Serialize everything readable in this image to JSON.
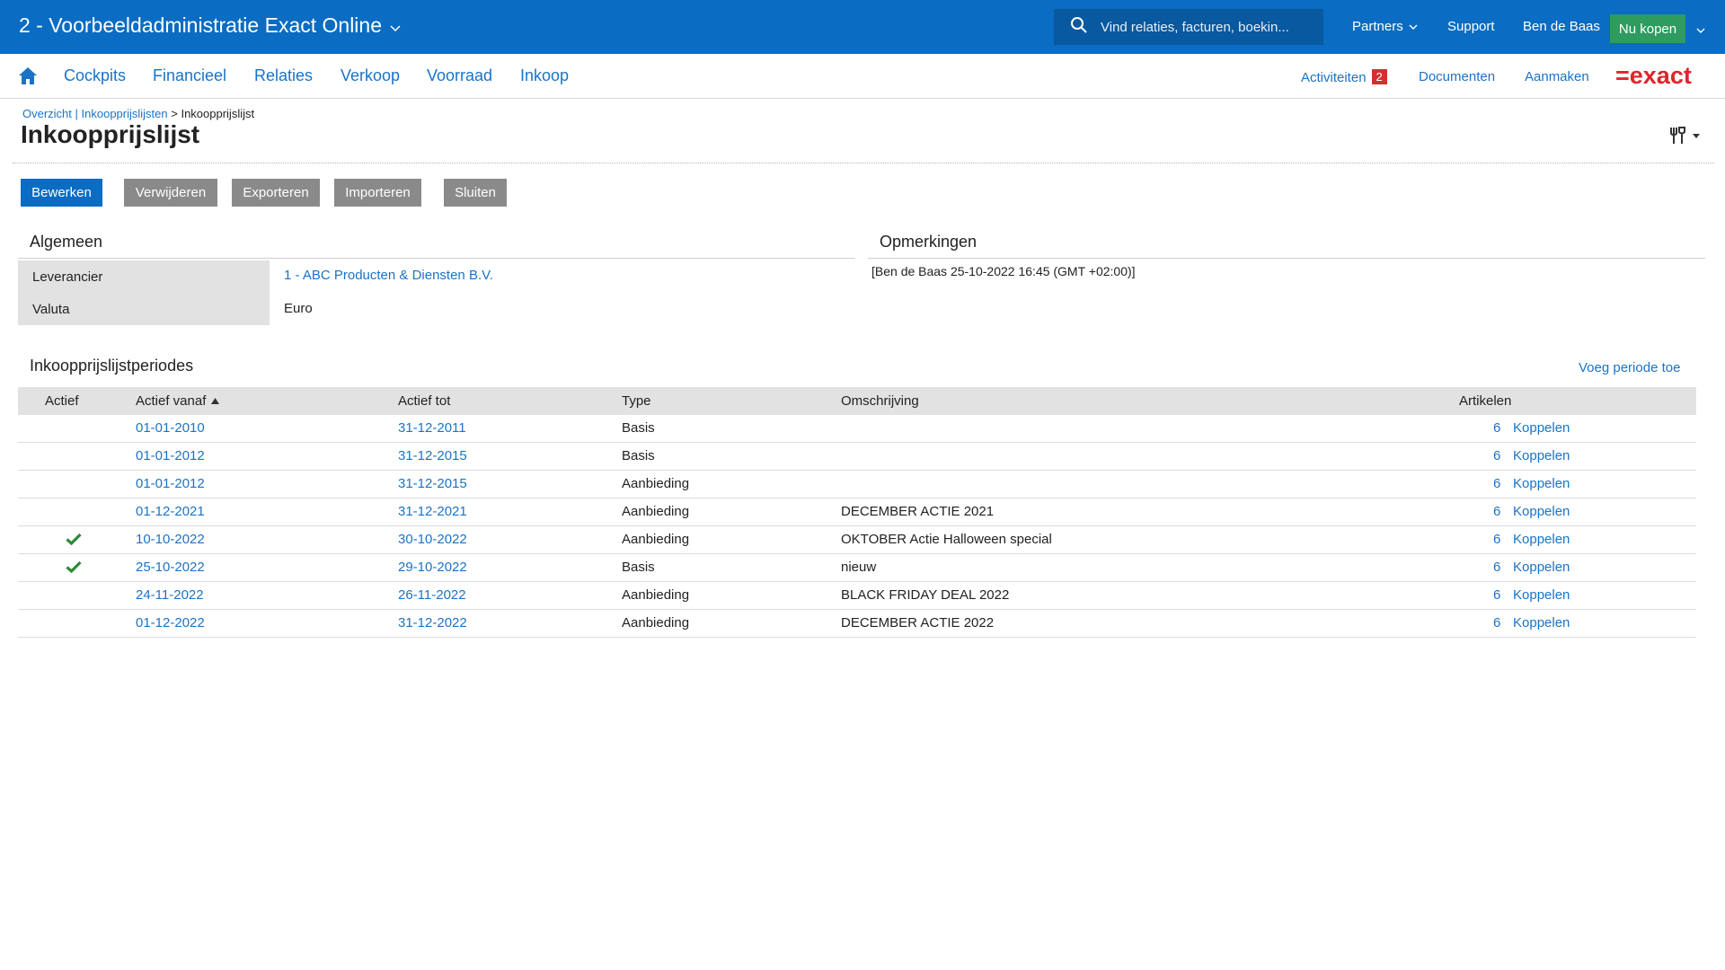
{
  "topbar": {
    "admin_title": "2 - Voorbeeldadministratie Exact Online",
    "search_placeholder": "Vind relaties, facturen, boekin...",
    "partners": "Partners",
    "support": "Support",
    "user": "Ben de Baas",
    "buy": "Nu kopen"
  },
  "nav": {
    "items": [
      "Cockpits",
      "Financieel",
      "Relaties",
      "Verkoop",
      "Voorraad",
      "Inkoop"
    ],
    "activities": "Activiteiten",
    "activities_count": "2",
    "documents": "Documenten",
    "create": "Aanmaken",
    "logo": "=exact"
  },
  "breadcrumb": {
    "overview": "Overzicht",
    "sep1": " | ",
    "lists": "Inkoopprijslijsten",
    "sep2": " > ",
    "current": "Inkoopprijslijst"
  },
  "page_title": "Inkoopprijslijst",
  "buttons": {
    "edit": "Bewerken",
    "delete": "Verwijderen",
    "export": "Exporteren",
    "import": "Importeren",
    "close": "Sluiten"
  },
  "general": {
    "heading": "Algemeen",
    "supplier_label": "Leverancier",
    "supplier_value": "1 - ABC Producten & Diensten B.V.",
    "currency_label": "Valuta",
    "currency_value": "Euro"
  },
  "remarks": {
    "heading": "Opmerkingen",
    "text": "[Ben de Baas 25-10-2022 16:45 (GMT +02:00)]"
  },
  "periods": {
    "heading": "Inkoopprijslijstperiodes",
    "add_link": "Voeg periode toe",
    "columns": {
      "active": "Actief",
      "from": "Actief vanaf",
      "to": "Actief tot",
      "type": "Type",
      "description": "Omschrijving",
      "articles": "Artikelen"
    },
    "link_label": "Koppelen",
    "rows": [
      {
        "active": false,
        "from": "01-01-2010",
        "to": "31-12-2011",
        "type": "Basis",
        "description": "",
        "articles": "6"
      },
      {
        "active": false,
        "from": "01-01-2012",
        "to": "31-12-2015",
        "type": "Basis",
        "description": "",
        "articles": "6"
      },
      {
        "active": false,
        "from": "01-01-2012",
        "to": "31-12-2015",
        "type": "Aanbieding",
        "description": "",
        "articles": "6"
      },
      {
        "active": false,
        "from": "01-12-2021",
        "to": "31-12-2021",
        "type": "Aanbieding",
        "description": "DECEMBER ACTIE 2021",
        "articles": "6"
      },
      {
        "active": true,
        "from": "10-10-2022",
        "to": "30-10-2022",
        "type": "Aanbieding",
        "description": "OKTOBER Actie Halloween special",
        "articles": "6"
      },
      {
        "active": true,
        "from": "25-10-2022",
        "to": "29-10-2022",
        "type": "Basis",
        "description": "nieuw",
        "articles": "6"
      },
      {
        "active": false,
        "from": "24-11-2022",
        "to": "26-11-2022",
        "type": "Aanbieding",
        "description": "BLACK FRIDAY DEAL 2022",
        "articles": "6"
      },
      {
        "active": false,
        "from": "01-12-2022",
        "to": "31-12-2022",
        "type": "Aanbieding",
        "description": "DECEMBER ACTIE 2022",
        "articles": "6"
      }
    ]
  },
  "colors": {
    "brand_blue": "#0a6cc2",
    "link_blue": "#1a73c7",
    "buy_green": "#2e9b5f",
    "check_green": "#2e8b3a",
    "badge_red": "#d32f2f",
    "logo_red": "#e0242b"
  }
}
